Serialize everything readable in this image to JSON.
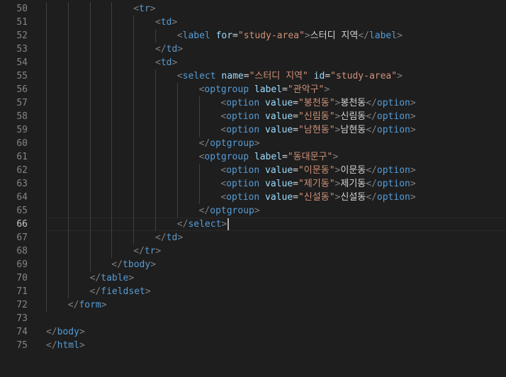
{
  "editor": {
    "theme": "dark",
    "colors": {
      "background": "#1e1e1e",
      "line_number": "#858585",
      "line_number_active": "#c6c6c6",
      "punctuation": "#808080",
      "tag": "#569cd6",
      "attribute": "#9cdcfe",
      "string": "#ce9178",
      "text": "#d4d4d4",
      "cursor": "#aeafad"
    },
    "active_line": 66,
    "cursor_after_token": "select-close-bracket",
    "lines": [
      {
        "n": 50,
        "indent": 4,
        "tokens": [
          {
            "t": "punct",
            "v": "<"
          },
          {
            "t": "tag",
            "v": "tr"
          },
          {
            "t": "punct",
            "v": ">"
          }
        ]
      },
      {
        "n": 51,
        "indent": 5,
        "tokens": [
          {
            "t": "punct",
            "v": "<"
          },
          {
            "t": "tag",
            "v": "td"
          },
          {
            "t": "punct",
            "v": ">"
          }
        ]
      },
      {
        "n": 52,
        "indent": 6,
        "tokens": [
          {
            "t": "punct",
            "v": "<"
          },
          {
            "t": "tag",
            "v": "label"
          },
          {
            "t": "text",
            "v": " "
          },
          {
            "t": "attr",
            "v": "for"
          },
          {
            "t": "eq",
            "v": "="
          },
          {
            "t": "str",
            "v": "\"study-area\""
          },
          {
            "t": "punct",
            "v": ">"
          },
          {
            "t": "text",
            "v": "스터디 지역"
          },
          {
            "t": "punct",
            "v": "</"
          },
          {
            "t": "tag",
            "v": "label"
          },
          {
            "t": "punct",
            "v": ">"
          }
        ]
      },
      {
        "n": 53,
        "indent": 5,
        "tokens": [
          {
            "t": "punct",
            "v": "</"
          },
          {
            "t": "tag",
            "v": "td"
          },
          {
            "t": "punct",
            "v": ">"
          }
        ]
      },
      {
        "n": 54,
        "indent": 5,
        "tokens": [
          {
            "t": "punct",
            "v": "<"
          },
          {
            "t": "tag",
            "v": "td"
          },
          {
            "t": "punct",
            "v": ">"
          }
        ]
      },
      {
        "n": 55,
        "indent": 6,
        "tokens": [
          {
            "t": "punct",
            "v": "<"
          },
          {
            "t": "tag",
            "v": "select"
          },
          {
            "t": "text",
            "v": " "
          },
          {
            "t": "attr",
            "v": "name"
          },
          {
            "t": "eq",
            "v": "="
          },
          {
            "t": "str",
            "v": "\"스터디 지역\""
          },
          {
            "t": "text",
            "v": " "
          },
          {
            "t": "attr",
            "v": "id"
          },
          {
            "t": "eq",
            "v": "="
          },
          {
            "t": "str",
            "v": "\"study-area\""
          },
          {
            "t": "punct",
            "v": ">"
          }
        ]
      },
      {
        "n": 56,
        "indent": 7,
        "tokens": [
          {
            "t": "punct",
            "v": "<"
          },
          {
            "t": "tag",
            "v": "optgroup"
          },
          {
            "t": "text",
            "v": " "
          },
          {
            "t": "attr",
            "v": "label"
          },
          {
            "t": "eq",
            "v": "="
          },
          {
            "t": "str",
            "v": "\"관악구\""
          },
          {
            "t": "punct",
            "v": ">"
          }
        ]
      },
      {
        "n": 57,
        "indent": 8,
        "tokens": [
          {
            "t": "punct",
            "v": "<"
          },
          {
            "t": "tag",
            "v": "option"
          },
          {
            "t": "text",
            "v": " "
          },
          {
            "t": "attr",
            "v": "value"
          },
          {
            "t": "eq",
            "v": "="
          },
          {
            "t": "str",
            "v": "\"봉천동\""
          },
          {
            "t": "punct",
            "v": ">"
          },
          {
            "t": "text",
            "v": "봉천동"
          },
          {
            "t": "punct",
            "v": "</"
          },
          {
            "t": "tag",
            "v": "option"
          },
          {
            "t": "punct",
            "v": ">"
          }
        ]
      },
      {
        "n": 58,
        "indent": 8,
        "tokens": [
          {
            "t": "punct",
            "v": "<"
          },
          {
            "t": "tag",
            "v": "option"
          },
          {
            "t": "text",
            "v": " "
          },
          {
            "t": "attr",
            "v": "value"
          },
          {
            "t": "eq",
            "v": "="
          },
          {
            "t": "str",
            "v": "\"신림동\""
          },
          {
            "t": "punct",
            "v": ">"
          },
          {
            "t": "text",
            "v": "신림동"
          },
          {
            "t": "punct",
            "v": "</"
          },
          {
            "t": "tag",
            "v": "option"
          },
          {
            "t": "punct",
            "v": ">"
          }
        ]
      },
      {
        "n": 59,
        "indent": 8,
        "tokens": [
          {
            "t": "punct",
            "v": "<"
          },
          {
            "t": "tag",
            "v": "option"
          },
          {
            "t": "text",
            "v": " "
          },
          {
            "t": "attr",
            "v": "value"
          },
          {
            "t": "eq",
            "v": "="
          },
          {
            "t": "str",
            "v": "\"남현동\""
          },
          {
            "t": "punct",
            "v": ">"
          },
          {
            "t": "text",
            "v": "남현동"
          },
          {
            "t": "punct",
            "v": "</"
          },
          {
            "t": "tag",
            "v": "option"
          },
          {
            "t": "punct",
            "v": ">"
          }
        ]
      },
      {
        "n": 60,
        "indent": 7,
        "tokens": [
          {
            "t": "punct",
            "v": "</"
          },
          {
            "t": "tag",
            "v": "optgroup"
          },
          {
            "t": "punct",
            "v": ">"
          }
        ]
      },
      {
        "n": 61,
        "indent": 7,
        "tokens": [
          {
            "t": "punct",
            "v": "<"
          },
          {
            "t": "tag",
            "v": "optgroup"
          },
          {
            "t": "text",
            "v": " "
          },
          {
            "t": "attr",
            "v": "label"
          },
          {
            "t": "eq",
            "v": "="
          },
          {
            "t": "str",
            "v": "\"동대문구\""
          },
          {
            "t": "punct",
            "v": ">"
          }
        ]
      },
      {
        "n": 62,
        "indent": 8,
        "tokens": [
          {
            "t": "punct",
            "v": "<"
          },
          {
            "t": "tag",
            "v": "option"
          },
          {
            "t": "text",
            "v": " "
          },
          {
            "t": "attr",
            "v": "value"
          },
          {
            "t": "eq",
            "v": "="
          },
          {
            "t": "str",
            "v": "\"이문동\""
          },
          {
            "t": "punct",
            "v": ">"
          },
          {
            "t": "text",
            "v": "이문동"
          },
          {
            "t": "punct",
            "v": "</"
          },
          {
            "t": "tag",
            "v": "option"
          },
          {
            "t": "punct",
            "v": ">"
          }
        ]
      },
      {
        "n": 63,
        "indent": 8,
        "tokens": [
          {
            "t": "punct",
            "v": "<"
          },
          {
            "t": "tag",
            "v": "option"
          },
          {
            "t": "text",
            "v": " "
          },
          {
            "t": "attr",
            "v": "value"
          },
          {
            "t": "eq",
            "v": "="
          },
          {
            "t": "str",
            "v": "\"제기동\""
          },
          {
            "t": "punct",
            "v": ">"
          },
          {
            "t": "text",
            "v": "제기동"
          },
          {
            "t": "punct",
            "v": "</"
          },
          {
            "t": "tag",
            "v": "option"
          },
          {
            "t": "punct",
            "v": ">"
          }
        ]
      },
      {
        "n": 64,
        "indent": 8,
        "tokens": [
          {
            "t": "punct",
            "v": "<"
          },
          {
            "t": "tag",
            "v": "option"
          },
          {
            "t": "text",
            "v": " "
          },
          {
            "t": "attr",
            "v": "value"
          },
          {
            "t": "eq",
            "v": "="
          },
          {
            "t": "str",
            "v": "\"신설동\""
          },
          {
            "t": "punct",
            "v": ">"
          },
          {
            "t": "text",
            "v": "신설동"
          },
          {
            "t": "punct",
            "v": "</"
          },
          {
            "t": "tag",
            "v": "option"
          },
          {
            "t": "punct",
            "v": ">"
          }
        ]
      },
      {
        "n": 65,
        "indent": 7,
        "tokens": [
          {
            "t": "punct",
            "v": "</"
          },
          {
            "t": "tag",
            "v": "optgroup"
          },
          {
            "t": "punct",
            "v": ">"
          }
        ]
      },
      {
        "n": 66,
        "indent": 6,
        "tokens": [
          {
            "t": "punct",
            "v": "</"
          },
          {
            "t": "tag",
            "v": "select"
          },
          {
            "t": "punct",
            "v": ">"
          }
        ]
      },
      {
        "n": 67,
        "indent": 5,
        "tokens": [
          {
            "t": "punct",
            "v": "</"
          },
          {
            "t": "tag",
            "v": "td"
          },
          {
            "t": "punct",
            "v": ">"
          }
        ]
      },
      {
        "n": 68,
        "indent": 4,
        "tokens": [
          {
            "t": "punct",
            "v": "</"
          },
          {
            "t": "tag",
            "v": "tr"
          },
          {
            "t": "punct",
            "v": ">"
          }
        ]
      },
      {
        "n": 69,
        "indent": 3,
        "tokens": [
          {
            "t": "punct",
            "v": "</"
          },
          {
            "t": "tag",
            "v": "tbody"
          },
          {
            "t": "punct",
            "v": ">"
          }
        ]
      },
      {
        "n": 70,
        "indent": 2,
        "tokens": [
          {
            "t": "punct",
            "v": "</"
          },
          {
            "t": "tag",
            "v": "table"
          },
          {
            "t": "punct",
            "v": ">"
          }
        ]
      },
      {
        "n": 71,
        "indent": 2,
        "tokens": [
          {
            "t": "punct",
            "v": "</"
          },
          {
            "t": "tag",
            "v": "fieldset"
          },
          {
            "t": "punct",
            "v": ">"
          }
        ]
      },
      {
        "n": 72,
        "indent": 1,
        "tokens": [
          {
            "t": "punct",
            "v": "</"
          },
          {
            "t": "tag",
            "v": "form"
          },
          {
            "t": "punct",
            "v": ">"
          }
        ]
      },
      {
        "n": 73,
        "indent": 0,
        "tokens": []
      },
      {
        "n": 74,
        "indent": 0,
        "tokens": [
          {
            "t": "punct",
            "v": "</"
          },
          {
            "t": "tag",
            "v": "body"
          },
          {
            "t": "punct",
            "v": ">"
          }
        ]
      },
      {
        "n": 75,
        "indent": 0,
        "tokens": [
          {
            "t": "punct",
            "v": "</"
          },
          {
            "t": "tag",
            "v": "html"
          },
          {
            "t": "punct",
            "v": ">"
          }
        ]
      }
    ]
  }
}
